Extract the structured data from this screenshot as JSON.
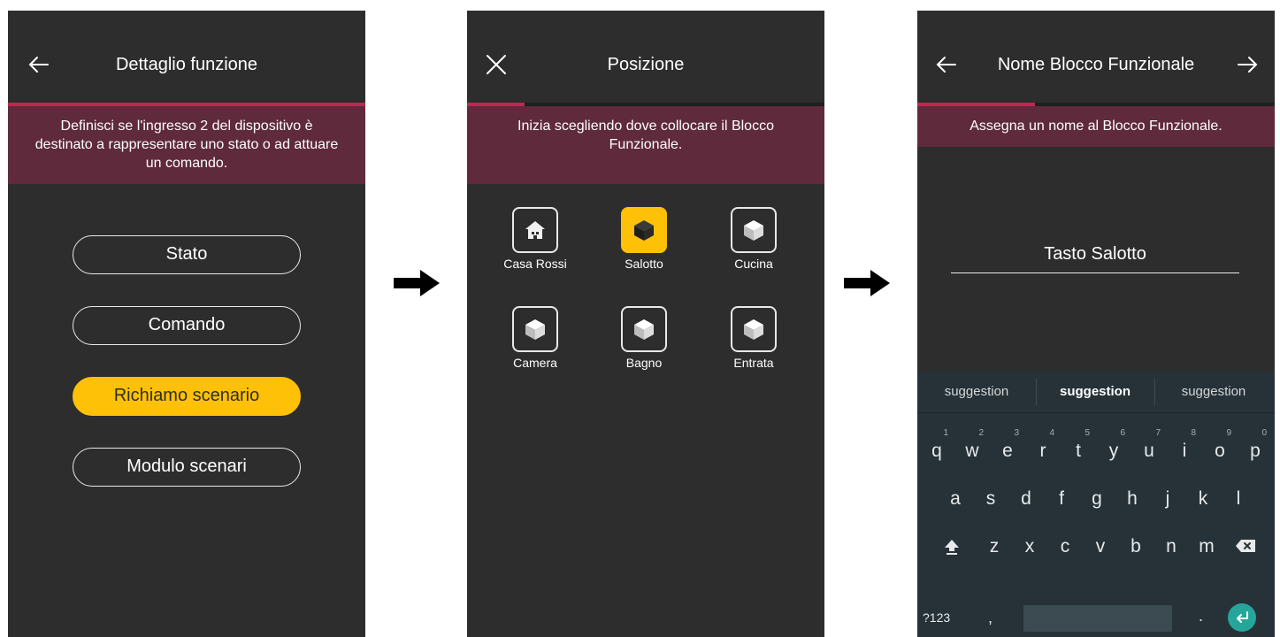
{
  "screen1": {
    "title": "Dettaglio funzione",
    "banner": "Definisci se l'ingresso 2 del dispositivo è destinato a rappresentare uno stato o ad attuare un comando.",
    "options": [
      "Stato",
      "Comando",
      "Richiamo scenario",
      "Modulo scenari"
    ],
    "selected_option": "Richiamo scenario",
    "progress_fraction": 1.0
  },
  "screen2": {
    "title": "Posizione",
    "banner": "Inizia scegliendo dove collocare il Blocco Funzionale.",
    "locations": [
      {
        "label": "Casa Rossi",
        "icon": "house-icon"
      },
      {
        "label": "Salotto",
        "icon": "cube-icon"
      },
      {
        "label": "Cucina",
        "icon": "cube-icon"
      },
      {
        "label": "Camera",
        "icon": "cube-icon"
      },
      {
        "label": "Bagno",
        "icon": "cube-icon"
      },
      {
        "label": "Entrata",
        "icon": "cube-icon"
      }
    ],
    "selected_location": "Salotto",
    "progress_fraction": 0.16
  },
  "screen3": {
    "title": "Nome Blocco Funzionale",
    "banner": "Assegna un nome al Blocco Funzionale.",
    "name_value": "Tasto Salotto",
    "progress_fraction": 0.33
  },
  "keyboard": {
    "suggestions": [
      "suggestion",
      "suggestion",
      "suggestion"
    ],
    "row1": [
      {
        "k": "q",
        "n": "1"
      },
      {
        "k": "w",
        "n": "2"
      },
      {
        "k": "e",
        "n": "3"
      },
      {
        "k": "r",
        "n": "4"
      },
      {
        "k": "t",
        "n": "5"
      },
      {
        "k": "y",
        "n": "6"
      },
      {
        "k": "u",
        "n": "7"
      },
      {
        "k": "i",
        "n": "8"
      },
      {
        "k": "o",
        "n": "9"
      },
      {
        "k": "p",
        "n": "0"
      }
    ],
    "row2": [
      "a",
      "s",
      "d",
      "f",
      "g",
      "h",
      "j",
      "k",
      "l"
    ],
    "row3": [
      "z",
      "x",
      "c",
      "v",
      "b",
      "n",
      "m"
    ],
    "symbols_label": "?123",
    "comma": ",",
    "period": "."
  },
  "colors": {
    "accent": "#c0264f",
    "banner": "#5f2a3b",
    "selected": "#ffc107",
    "screen_bg": "#2d2d2d",
    "keyboard_bg": "#263238",
    "enter_key": "#26a69a"
  }
}
